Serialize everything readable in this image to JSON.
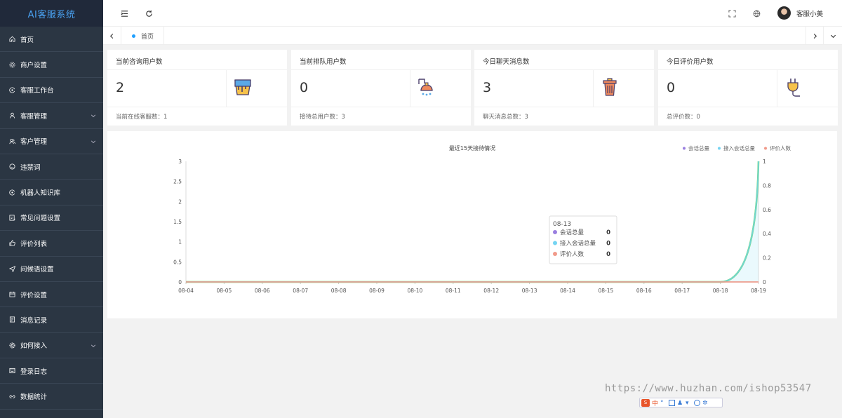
{
  "app": {
    "title": "AI客服系统"
  },
  "sidebar": {
    "items": [
      {
        "label": "首页",
        "icon": "home-icon",
        "expandable": false
      },
      {
        "label": "商户设置",
        "icon": "settings-icon",
        "expandable": false
      },
      {
        "label": "客服工作台",
        "icon": "workbench-icon",
        "expandable": false
      },
      {
        "label": "客服管理",
        "icon": "user-icon",
        "expandable": true
      },
      {
        "label": "客户管理",
        "icon": "users-icon",
        "expandable": true
      },
      {
        "label": "违禁词",
        "icon": "smile-icon",
        "expandable": false
      },
      {
        "label": "机器人知识库",
        "icon": "robot-icon",
        "expandable": false
      },
      {
        "label": "常见问题设置",
        "icon": "edit-icon",
        "expandable": false
      },
      {
        "label": "评价列表",
        "icon": "thumb-icon",
        "expandable": false
      },
      {
        "label": "问候语设置",
        "icon": "send-icon",
        "expandable": false
      },
      {
        "label": "评价设置",
        "icon": "calendar-icon",
        "expandable": false
      },
      {
        "label": "消息记录",
        "icon": "message-icon",
        "expandable": false
      },
      {
        "label": "如何接入",
        "icon": "gear-icon",
        "expandable": true
      },
      {
        "label": "登录日志",
        "icon": "log-icon",
        "expandable": false
      },
      {
        "label": "数据统计",
        "icon": "link-icon",
        "expandable": false
      }
    ]
  },
  "topbar": {
    "username": "客服小美"
  },
  "tabs": {
    "home_label": "首页"
  },
  "cards": [
    {
      "title": "当前咨询用户数",
      "value": "2",
      "footer": "当前在线客服数：1",
      "icon": "paint-bucket-icon"
    },
    {
      "title": "当前排队用户数",
      "value": "0",
      "footer": "接待总用户数：3",
      "icon": "shower-icon"
    },
    {
      "title": "今日聊天消息数",
      "value": "3",
      "footer": "聊天消息总数：3",
      "icon": "trash-icon"
    },
    {
      "title": "今日评价用户数",
      "value": "0",
      "footer": "总评价数：0",
      "icon": "plug-icon"
    }
  ],
  "chart_data": {
    "type": "line",
    "title": "最近15天接待情况",
    "x": [
      "08-04",
      "08-05",
      "08-06",
      "08-07",
      "08-08",
      "08-09",
      "08-10",
      "08-11",
      "08-12",
      "08-13",
      "08-14",
      "08-15",
      "08-16",
      "08-17",
      "08-18",
      "08-19"
    ],
    "y_left": {
      "ticks": [
        "0",
        "0.5",
        "1",
        "1.5",
        "2",
        "2.5",
        "3"
      ],
      "range": [
        0,
        3
      ]
    },
    "y_right": {
      "ticks": [
        "0",
        "0.2",
        "0.4",
        "0.6",
        "0.8",
        "1"
      ],
      "range": [
        0,
        1
      ]
    },
    "series": [
      {
        "name": "会话总量",
        "color": "#9a7fe0",
        "axis": "left",
        "values": [
          0,
          0,
          0,
          0,
          0,
          0,
          0,
          0,
          0,
          0,
          0,
          0,
          0,
          0,
          0,
          3
        ]
      },
      {
        "name": "接入会话总量",
        "color": "#74d4f2",
        "axis": "left",
        "values": [
          0,
          0,
          0,
          0,
          0,
          0,
          0,
          0,
          0,
          0,
          0,
          0,
          0,
          0,
          0,
          3
        ]
      },
      {
        "name": "评价人数",
        "color": "#f19a8a",
        "axis": "right",
        "values": [
          0,
          0,
          0,
          0,
          0,
          0,
          0,
          0,
          0,
          0,
          0,
          0,
          0,
          0,
          0,
          0
        ]
      }
    ],
    "highlight_color": "#6cd64a",
    "legend_placement": "top-right",
    "tooltip": {
      "title": "08-13",
      "rows": [
        {
          "name": "会话总量",
          "value": "0",
          "color": "#9a7fe0"
        },
        {
          "name": "接入会话总量",
          "value": "0",
          "color": "#74d4f2"
        },
        {
          "name": "评价人数",
          "value": "0",
          "color": "#f19a8a"
        }
      ]
    }
  },
  "watermark": {
    "text": "https://www.huzhan.com/ishop53547"
  },
  "ime": {
    "label": "中"
  }
}
